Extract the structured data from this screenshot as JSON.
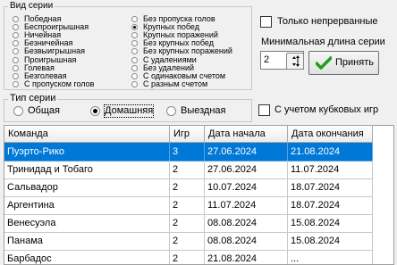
{
  "series_kind": {
    "caption": "Вид серии",
    "left_options": [
      "Победная",
      "Беспроигрышная",
      "Ничейная",
      "Безничейная",
      "Безвыигрышная",
      "Проигрышная",
      "Голевая",
      "Безголевая",
      "С пропуском голов"
    ],
    "right_options": [
      "Без пропуска голов",
      "Крупных побед",
      "Крупных поражений",
      "Без крупных побед",
      "Без крупных поражений",
      "С удалениями",
      "Без удалений",
      "С одинаковым счетом",
      "С разным счетом"
    ],
    "selected": "Крупных побед"
  },
  "options": {
    "only_continuous_label": "Только непрерванные",
    "only_continuous_checked": false,
    "min_length_label": "Минимальная длина серии",
    "min_length_value": "2",
    "apply_label": "Принять"
  },
  "series_type": {
    "caption": "Тип серии",
    "options": [
      "Общая",
      "Домашняя",
      "Выездная"
    ],
    "selected": "Домашняя"
  },
  "cup_games": {
    "label": "С учетом кубковых игр",
    "checked": false
  },
  "table": {
    "columns": [
      "Команда",
      "Игр",
      "Дата начала",
      "Дата окончания"
    ],
    "rows": [
      [
        "Пуэрто-Рико",
        "3",
        "27.06.2024",
        "21.08.2024"
      ],
      [
        "Тринидад и Тобаго",
        "2",
        "27.06.2024",
        "11.07.2024"
      ],
      [
        "Сальвадор",
        "2",
        "10.07.2024",
        "18.07.2024"
      ],
      [
        "Аргентина",
        "2",
        "11.07.2024",
        "18.07.2024"
      ],
      [
        "Венесуэла",
        "2",
        "08.08.2024",
        "15.08.2024"
      ],
      [
        "Панама",
        "2",
        "08.08.2024",
        "15.08.2024"
      ],
      [
        "Барбадос",
        "2",
        "21.08.2024",
        "..."
      ]
    ],
    "selected_row": 0
  },
  "colors": {
    "selection": "#0078d7",
    "apply_check": "#1ea01e"
  }
}
